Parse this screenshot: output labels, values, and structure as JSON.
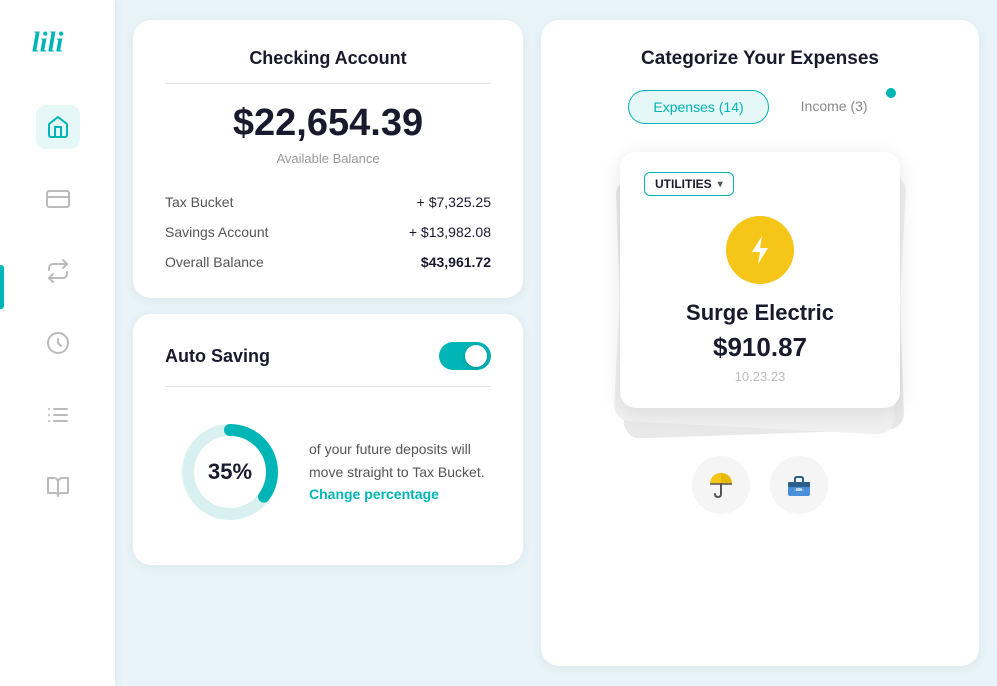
{
  "sidebar": {
    "logo_text": "lili",
    "items": [
      {
        "name": "home",
        "label": "Home",
        "active": true
      },
      {
        "name": "cards",
        "label": "Cards",
        "active": false
      },
      {
        "name": "transfers",
        "label": "Transfers",
        "active": false
      },
      {
        "name": "savings",
        "label": "Savings",
        "active": false
      },
      {
        "name": "reports",
        "label": "Reports",
        "active": false
      },
      {
        "name": "books",
        "label": "Books",
        "active": false
      }
    ]
  },
  "checking": {
    "title": "Checking Account",
    "balance": "$22,654.39",
    "balance_label": "Available Balance",
    "rows": [
      {
        "label": "Tax Bucket",
        "value": "+ $7,325.25"
      },
      {
        "label": "Savings Account",
        "value": "+ $13,982.08"
      },
      {
        "label": "Overall Balance",
        "value": "$43,961.72"
      }
    ]
  },
  "auto_saving": {
    "title": "Auto Saving",
    "toggle_on": true,
    "percentage": "35%",
    "description": "of your future deposits will move straight to Tax Bucket.",
    "change_link": "Change percentage",
    "donut_percent": 35
  },
  "categorize": {
    "title": "Categorize Your Expenses",
    "tabs": [
      {
        "label": "Expenses (14)",
        "active": true,
        "has_dot": false
      },
      {
        "label": "Income (3)",
        "active": false,
        "has_dot": true
      }
    ],
    "current_expense": {
      "category": "UTILITIES",
      "merchant": "Surge Electric",
      "amount": "$910.87",
      "date": "10.23.23"
    },
    "action_icons": [
      {
        "name": "personal-icon",
        "label": "Personal"
      },
      {
        "name": "business-icon",
        "label": "Business"
      }
    ]
  }
}
